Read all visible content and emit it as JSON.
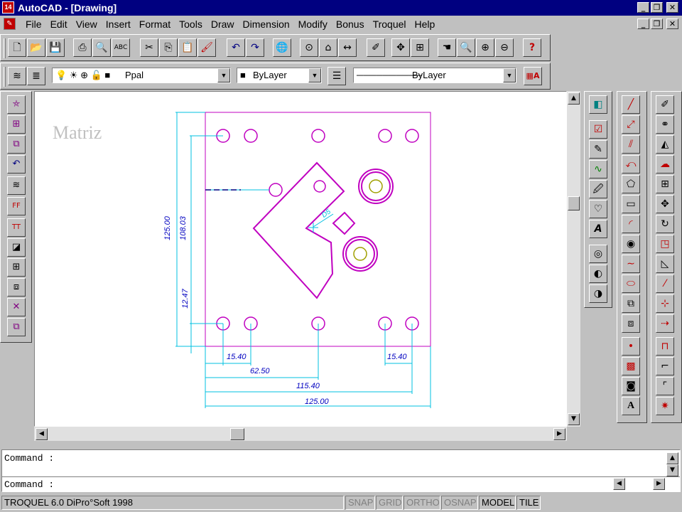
{
  "window": {
    "title": "AutoCAD - [Drawing]",
    "app_icon": "14",
    "controls": [
      "_",
      "▫",
      "✕"
    ]
  },
  "menu": {
    "items": [
      "File",
      "Edit",
      "View",
      "Insert",
      "Format",
      "Tools",
      "Draw",
      "Dimension",
      "Modify",
      "Bonus",
      "Troquel",
      "Help"
    ]
  },
  "standard_toolbar": {
    "tools": [
      "new-icon",
      "open-icon",
      "save-icon",
      "print-icon",
      "preview-icon",
      "spell-icon",
      "cut-icon",
      "copy-icon",
      "paste-icon",
      "match-icon",
      "undo-icon",
      "redo-icon",
      "browser-icon",
      "snap-icon",
      "ucs-icon",
      "distance-icon",
      "redraw-icon",
      "pan-icon",
      "zoom-realtime-icon",
      "zoom-window-icon",
      "zoom-previous-icon",
      "zoom-all-icon",
      "help-icon"
    ]
  },
  "properties_toolbar": {
    "layer_value": "Ppal",
    "color_value": "ByLayer",
    "linetype_value": "ByLayer"
  },
  "drawing": {
    "annotation": "Matriz",
    "dimensions": {
      "h_15_40_a": "15.40",
      "h_15_40_b": "15.40",
      "h_62_50": "62.50",
      "h_115_40": "115.40",
      "h_125_00": "125.00",
      "v_125_00": "125.00",
      "v_108_03": "108.03",
      "v_12_47": "12.47",
      "inner": "D5"
    }
  },
  "command": {
    "line1": "Command :",
    "line2": "Command :"
  },
  "status": {
    "text": "TROQUEL 6.0 DiPro°Soft 1998",
    "snap": "SNAP",
    "grid": "GRID",
    "ortho": "ORTHO",
    "osnap": "OSNAP",
    "model": "MODEL",
    "tile": "TILE"
  },
  "colors": {
    "title_bar": "#000080",
    "part_outline": "#c000c0",
    "dimension": "#00c0e0",
    "dim_text": "#0000c0",
    "inner_circle": "#a0a000"
  }
}
